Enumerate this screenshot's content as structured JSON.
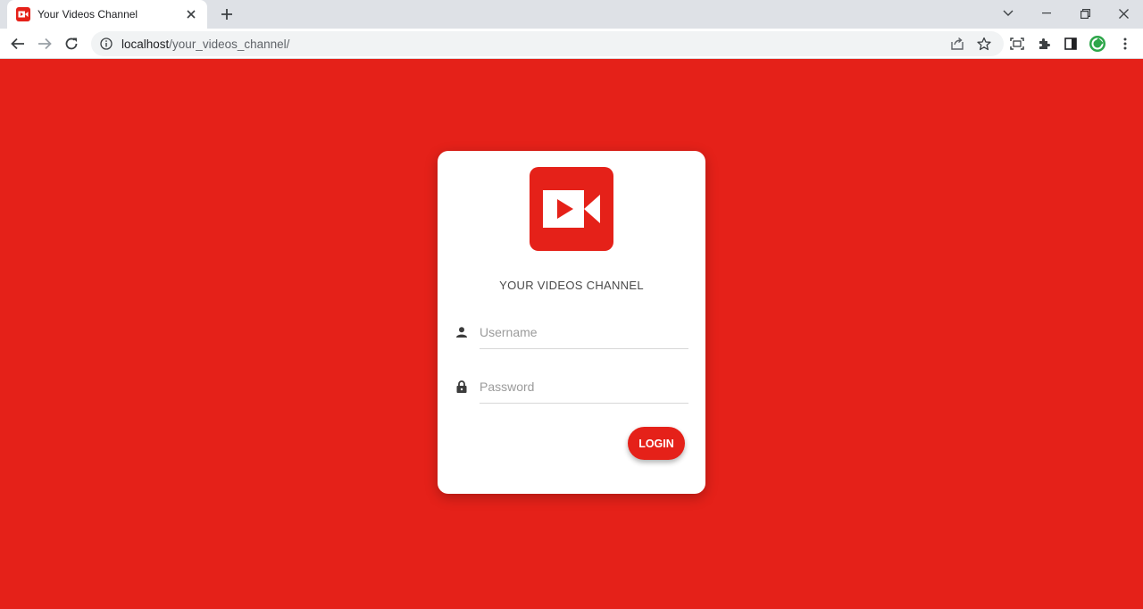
{
  "browser": {
    "tab": {
      "title": "Your Videos Channel",
      "favicon": "video-camera-icon"
    },
    "address_bar": {
      "host": "localhost",
      "path": "/your_videos_channel/"
    },
    "profile_color": "#2ea64a"
  },
  "login": {
    "brand": "YOUR VIDEOS CHANNEL",
    "username_placeholder": "Username",
    "password_placeholder": "Password",
    "login_label": "LOGIN"
  },
  "colors": {
    "accent": "#e52119",
    "card": "#ffffff"
  }
}
